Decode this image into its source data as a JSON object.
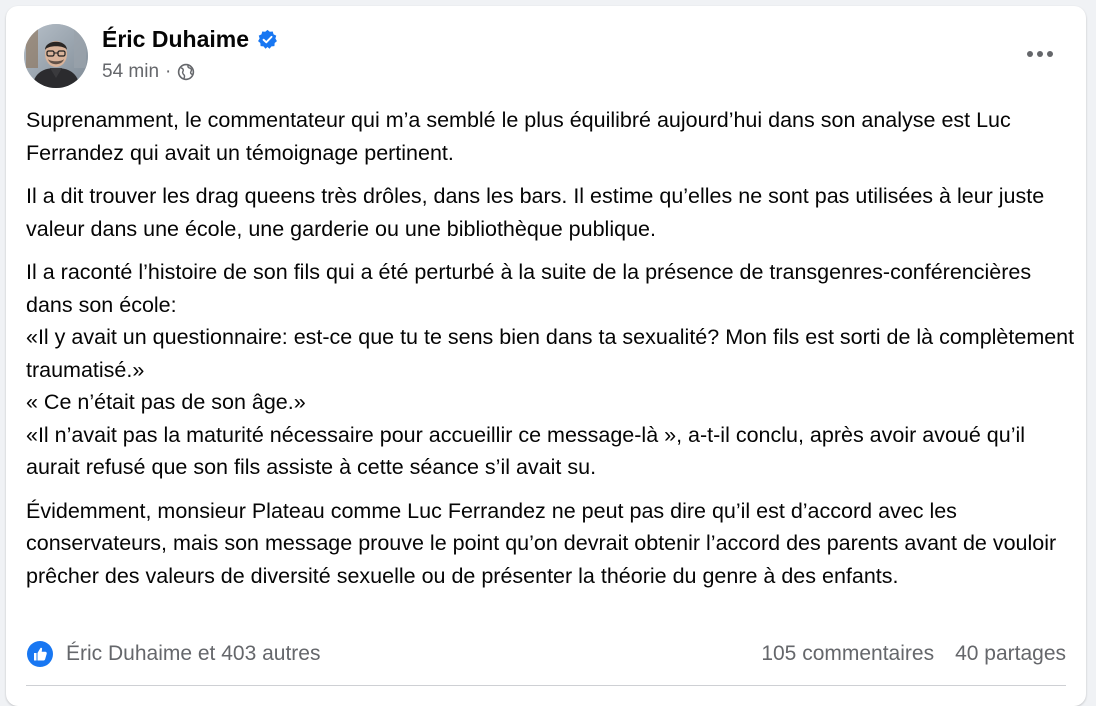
{
  "post": {
    "author": {
      "name": "Éric Duhaime",
      "verified": true
    },
    "time": "54 min",
    "separator": "·",
    "audience_icon": "globe-icon",
    "more_icon": "more-horizontal-icon",
    "paragraphs": [
      [
        "Suprenamment, le commentateur qui m’a semblé le plus équilibré aujourd’hui dans son analyse est Luc Ferrandez qui avait un témoignage pertinent."
      ],
      [
        "Il a dit trouver les drag queens très drôles, dans les bars. Il estime qu’elles ne sont pas utilisées à leur juste valeur dans une école, une garderie ou une bibliothèque publique."
      ],
      [
        "Il a raconté l’histoire de son fils qui a été perturbé à la suite de la présence de transgenres-conférencières dans son école:",
        "«Il y avait un questionnaire: est-ce que tu te sens bien dans ta sexualité? Mon fils est sorti de là complètement traumatisé.»",
        "« Ce n’était pas de son âge.»",
        "«Il n’avait pas la maturité nécessaire pour accueillir ce message-là », a-t-il conclu, après avoir avoué qu’il aurait refusé que son fils assiste à cette séance s’il avait su."
      ],
      [
        "Évidemment, monsieur Plateau comme Luc Ferrandez ne peut pas dire qu’il est d’accord avec les conservateurs, mais son message prouve le point qu’on devrait obtenir l’accord des parents avant de vouloir prêcher des valeurs de diversité sexuelle ou de présenter la théorie du genre à des enfants."
      ]
    ],
    "footer": {
      "reactions_label": "Éric Duhaime et 403 autres",
      "comments_label": "105 commentaires",
      "shares_label": "40 partages",
      "reaction_icon": "like-icon"
    },
    "colors": {
      "verified_blue": "#1877f2",
      "like_blue": "#1877f2",
      "secondary_text": "#65676b"
    }
  }
}
